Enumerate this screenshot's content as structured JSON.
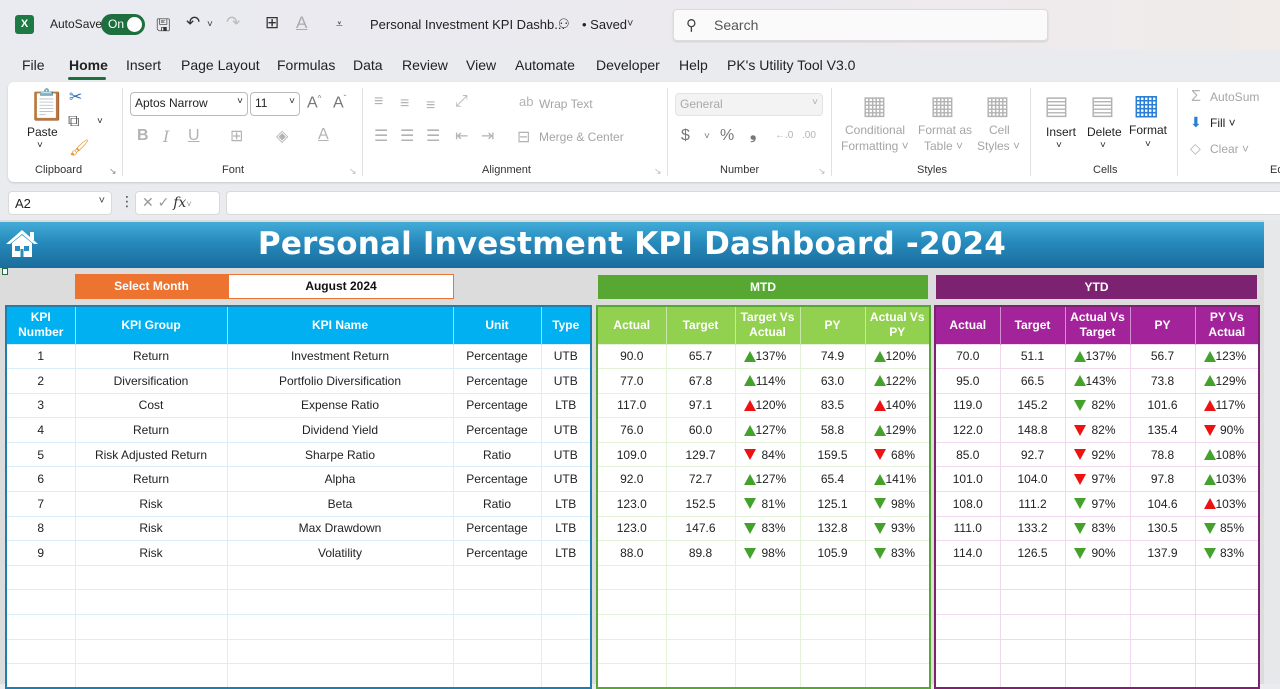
{
  "titlebar": {
    "autosave_label": "AutoSave",
    "autosave_state": "On",
    "document_title": "Personal Investment KPI Dashb...",
    "save_status": "• Saved",
    "search_placeholder": "Search"
  },
  "menu": {
    "items": [
      "File",
      "Home",
      "Insert",
      "Page Layout",
      "Formulas",
      "Data",
      "Review",
      "View",
      "Automate",
      "Developer",
      "Help",
      "PK's Utility Tool V3.0"
    ],
    "active": "Home"
  },
  "ribbon": {
    "clipboard": {
      "label": "Clipboard",
      "paste": "Paste"
    },
    "font": {
      "label": "Font",
      "font_name": "Aptos Narrow",
      "font_size": "11"
    },
    "alignment": {
      "label": "Alignment",
      "wrap_text": "Wrap Text",
      "merge_center": "Merge & Center"
    },
    "number": {
      "label": "Number",
      "format": "General"
    },
    "styles": {
      "label": "Styles",
      "conditional_1": "Conditional",
      "conditional_2": "Formatting ˅",
      "format_table_1": "Format as",
      "format_table_2": "Table ˅",
      "cell_styles_1": "Cell",
      "cell_styles_2": "Styles ˅"
    },
    "cells": {
      "label": "Cells",
      "insert": "Insert",
      "delete": "Delete",
      "format": "Format"
    },
    "editing": {
      "label": "Ed",
      "autosum": "AutoSum",
      "fill": "Fill ˅",
      "clear": "Clear ˅"
    }
  },
  "formula_bar": {
    "name_box": "A2",
    "fx": "fx",
    "formula": ""
  },
  "dashboard": {
    "title": "Personal Investment KPI Dashboard -2024",
    "select_month_label": "Select Month",
    "selected_month": "August 2024",
    "mtd_title": "MTD",
    "ytd_title": "YTD",
    "colors": {
      "banner": "#2689bb",
      "select": "#ec7330",
      "mtd": "#57a833",
      "mtd_header": "#92d050",
      "ytd": "#7c2271",
      "ytd_header": "#a3249a",
      "kpi_header": "#00b0f0",
      "up_good": "#44a22c",
      "bad": "#ee1111"
    },
    "left_headers": [
      "KPI Number",
      "KPI Group",
      "KPI Name",
      "Unit",
      "Type"
    ],
    "mtd_headers": [
      "Actual",
      "Target",
      "Target Vs Actual",
      "PY",
      "Actual Vs PY"
    ],
    "ytd_headers": [
      "Actual",
      "Target",
      "Actual Vs Target",
      "PY",
      "PY Vs Actual"
    ],
    "rows": [
      {
        "num": "1",
        "group": "Return",
        "name": "Investment Return",
        "unit": "Percentage",
        "type": "UTB",
        "mtd": {
          "actual": "90.0",
          "target": "65.7",
          "tva": "137%",
          "tva_dir": "up",
          "tva_color": "green",
          "py": "74.9",
          "avp": "120%",
          "avp_dir": "up",
          "avp_color": "green"
        },
        "ytd": {
          "actual": "70.0",
          "target": "51.1",
          "avt": "137%",
          "avt_dir": "up",
          "avt_color": "green",
          "py": "56.7",
          "pva": "123%",
          "pva_dir": "up",
          "pva_color": "green"
        }
      },
      {
        "num": "2",
        "group": "Diversification",
        "name": "Portfolio Diversification",
        "unit": "Percentage",
        "type": "UTB",
        "mtd": {
          "actual": "77.0",
          "target": "67.8",
          "tva": "114%",
          "tva_dir": "up",
          "tva_color": "green",
          "py": "63.0",
          "avp": "122%",
          "avp_dir": "up",
          "avp_color": "green"
        },
        "ytd": {
          "actual": "95.0",
          "target": "66.5",
          "avt": "143%",
          "avt_dir": "up",
          "avt_color": "green",
          "py": "73.8",
          "pva": "129%",
          "pva_dir": "up",
          "pva_color": "green"
        }
      },
      {
        "num": "3",
        "group": "Cost",
        "name": "Expense Ratio",
        "unit": "Percentage",
        "type": "LTB",
        "mtd": {
          "actual": "117.0",
          "target": "97.1",
          "tva": "120%",
          "tva_dir": "up",
          "tva_color": "red",
          "py": "83.5",
          "avp": "140%",
          "avp_dir": "up",
          "avp_color": "red"
        },
        "ytd": {
          "actual": "119.0",
          "target": "145.2",
          "avt": "82%",
          "avt_dir": "down",
          "avt_color": "green",
          "py": "101.6",
          "pva": "117%",
          "pva_dir": "up",
          "pva_color": "red"
        }
      },
      {
        "num": "4",
        "group": "Return",
        "name": "Dividend Yield",
        "unit": "Percentage",
        "type": "UTB",
        "mtd": {
          "actual": "76.0",
          "target": "60.0",
          "tva": "127%",
          "tva_dir": "up",
          "tva_color": "green",
          "py": "58.8",
          "avp": "129%",
          "avp_dir": "up",
          "avp_color": "green"
        },
        "ytd": {
          "actual": "122.0",
          "target": "148.8",
          "avt": "82%",
          "avt_dir": "down",
          "avt_color": "red",
          "py": "135.4",
          "pva": "90%",
          "pva_dir": "down",
          "pva_color": "red"
        }
      },
      {
        "num": "5",
        "group": "Risk Adjusted Return",
        "name": "Sharpe Ratio",
        "unit": "Ratio",
        "type": "UTB",
        "mtd": {
          "actual": "109.0",
          "target": "129.7",
          "tva": "84%",
          "tva_dir": "down",
          "tva_color": "red",
          "py": "159.5",
          "avp": "68%",
          "avp_dir": "down",
          "avp_color": "red"
        },
        "ytd": {
          "actual": "85.0",
          "target": "92.7",
          "avt": "92%",
          "avt_dir": "down",
          "avt_color": "red",
          "py": "78.8",
          "pva": "108%",
          "pva_dir": "up",
          "pva_color": "green"
        }
      },
      {
        "num": "6",
        "group": "Return",
        "name": "Alpha",
        "unit": "Percentage",
        "type": "UTB",
        "mtd": {
          "actual": "92.0",
          "target": "72.7",
          "tva": "127%",
          "tva_dir": "up",
          "tva_color": "green",
          "py": "65.4",
          "avp": "141%",
          "avp_dir": "up",
          "avp_color": "green"
        },
        "ytd": {
          "actual": "101.0",
          "target": "104.0",
          "avt": "97%",
          "avt_dir": "down",
          "avt_color": "red",
          "py": "97.8",
          "pva": "103%",
          "pva_dir": "up",
          "pva_color": "green"
        }
      },
      {
        "num": "7",
        "group": "Risk",
        "name": "Beta",
        "unit": "Ratio",
        "type": "LTB",
        "mtd": {
          "actual": "123.0",
          "target": "152.5",
          "tva": "81%",
          "tva_dir": "down",
          "tva_color": "green",
          "py": "125.1",
          "avp": "98%",
          "avp_dir": "down",
          "avp_color": "green"
        },
        "ytd": {
          "actual": "108.0",
          "target": "111.2",
          "avt": "97%",
          "avt_dir": "down",
          "avt_color": "green",
          "py": "104.6",
          "pva": "103%",
          "pva_dir": "up",
          "pva_color": "red"
        }
      },
      {
        "num": "8",
        "group": "Risk",
        "name": "Max Drawdown",
        "unit": "Percentage",
        "type": "LTB",
        "mtd": {
          "actual": "123.0",
          "target": "147.6",
          "tva": "83%",
          "tva_dir": "down",
          "tva_color": "green",
          "py": "132.8",
          "avp": "93%",
          "avp_dir": "down",
          "avp_color": "green"
        },
        "ytd": {
          "actual": "111.0",
          "target": "133.2",
          "avt": "83%",
          "avt_dir": "down",
          "avt_color": "green",
          "py": "130.5",
          "pva": "85%",
          "pva_dir": "down",
          "pva_color": "green"
        }
      },
      {
        "num": "9",
        "group": "Risk",
        "name": "Volatility",
        "unit": "Percentage",
        "type": "LTB",
        "mtd": {
          "actual": "88.0",
          "target": "89.8",
          "tva": "98%",
          "tva_dir": "down",
          "tva_color": "green",
          "py": "105.9",
          "avp": "83%",
          "avp_dir": "down",
          "avp_color": "green"
        },
        "ytd": {
          "actual": "114.0",
          "target": "126.5",
          "avt": "90%",
          "avt_dir": "down",
          "avt_color": "green",
          "py": "137.9",
          "pva": "83%",
          "pva_dir": "down",
          "pva_color": "green"
        }
      }
    ],
    "empty_rows": 5
  }
}
